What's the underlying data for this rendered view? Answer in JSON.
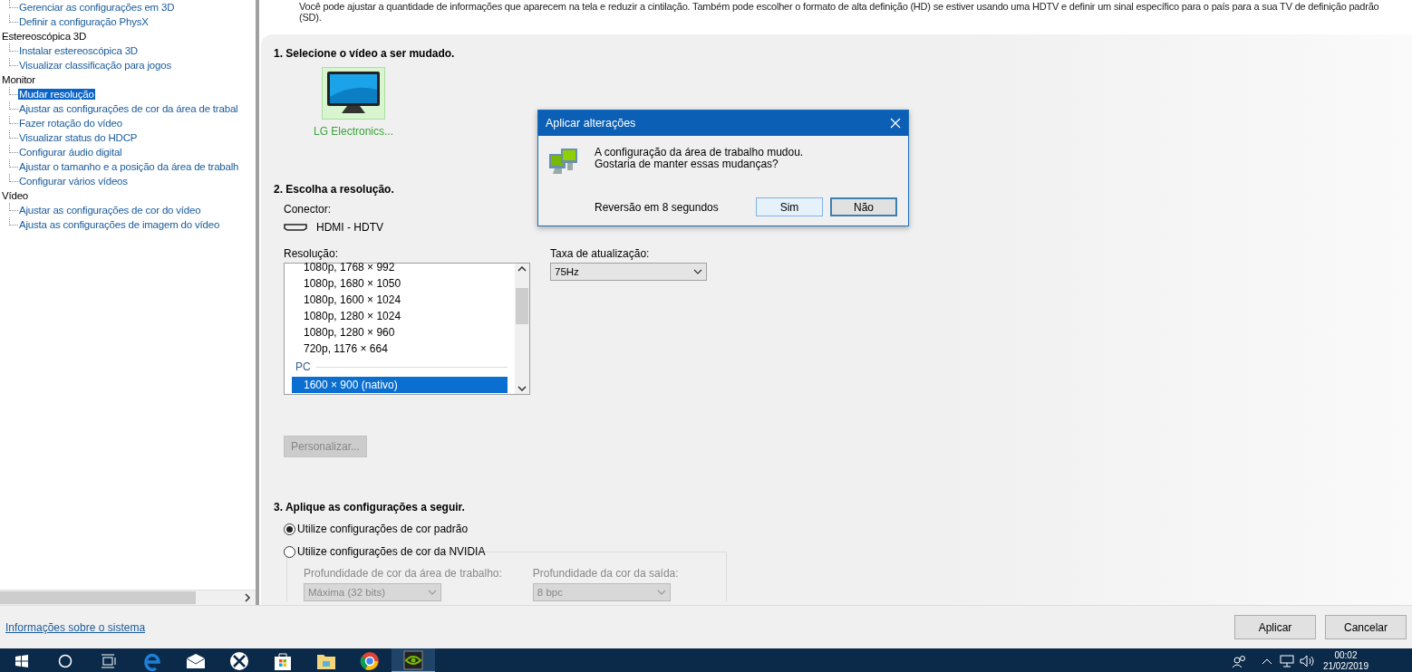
{
  "sidebar": {
    "items": [
      {
        "children": [
          {
            "label": "Gerenciar as configurações em 3D",
            "selected": false
          },
          {
            "label": "Definir a configuração PhysX",
            "selected": false
          }
        ]
      },
      {
        "label": "Estereoscópica 3D",
        "children": [
          {
            "label": "Instalar estereoscópica 3D",
            "selected": false
          },
          {
            "label": "Visualizar classificação para jogos",
            "selected": false
          }
        ]
      },
      {
        "label": "Monitor",
        "children": [
          {
            "label": "Mudar resolução",
            "selected": true
          },
          {
            "label": "Ajustar as configurações de cor da área de trabal",
            "selected": false
          },
          {
            "label": "Fazer rotação do vídeo",
            "selected": false
          },
          {
            "label": "Visualizar status do HDCP",
            "selected": false
          },
          {
            "label": "Configurar áudio digital",
            "selected": false
          },
          {
            "label": "Ajustar o tamanho e a posição da área de trabalh",
            "selected": false
          },
          {
            "label": "Configurar vários vídeos",
            "selected": false
          }
        ]
      },
      {
        "label": "Vídeo",
        "children": [
          {
            "label": "Ajustar as configurações de cor do vídeo",
            "selected": false
          },
          {
            "label": "Ajusta as configurações de imagem do vídeo",
            "selected": false
          }
        ]
      }
    ]
  },
  "description": "Você pode ajustar a quantidade de informações que aparecem na tela e reduzir  a cintilação. Também pode escolher o formato de alta definição (HD) se estiver usando uma HDTV e definir um sinal específico para o país para a sua TV de definição padrão (SD).",
  "section_1": {
    "heading": "1. Selecione o vídeo a ser mudado.",
    "displays": [
      {
        "label": "LG Electronics...",
        "selected": true
      }
    ]
  },
  "section_2": {
    "heading": "2. Escolha a resolução.",
    "connector_label": "Conector:",
    "connector": "HDMI - HDTV",
    "resolution_label": "Resolução:",
    "resolutions": [
      {
        "kind": "item",
        "label": "1080p, 1768 × 992",
        "selected": false
      },
      {
        "kind": "item",
        "label": "1080p, 1680 × 1050",
        "selected": false
      },
      {
        "kind": "item",
        "label": "1080p, 1600 × 1024",
        "selected": false
      },
      {
        "kind": "item",
        "label": "1080p, 1280 × 1024",
        "selected": false
      },
      {
        "kind": "item",
        "label": "1080p, 1280 × 960",
        "selected": false
      },
      {
        "kind": "item",
        "label": "720p, 1176 × 664",
        "selected": false
      },
      {
        "kind": "group",
        "label": "PC"
      },
      {
        "kind": "item",
        "label": "1600 × 900 (nativo)",
        "selected": true
      }
    ],
    "refresh_label": "Taxa de atualização:",
    "refresh_value": "75Hz",
    "customize_button": {
      "label": "Personalizar...",
      "disabled": true
    }
  },
  "section_3": {
    "heading": "3. Aplique as configurações a seguir.",
    "options": [
      {
        "label": "Utilize configurações de cor padrão",
        "selected": true
      },
      {
        "label": "Utilize configurações de cor da NVIDIA",
        "selected": false
      }
    ],
    "fields": [
      {
        "label": "Profundidade de cor da área de trabalho:",
        "value": "Máxima (32 bits)",
        "disabled": true
      },
      {
        "label": "Profundidade da cor da saída:",
        "value": "8 bpc",
        "disabled": true
      }
    ]
  },
  "dialog": {
    "title": "Aplicar alterações",
    "message": [
      "A configuração da área de trabalho mudou.",
      "Gostaria de manter essas mudanças?"
    ],
    "countdown": "Reversão em 8 segundos",
    "buttons": [
      {
        "label": "Sim",
        "kind": "hover"
      },
      {
        "label": "Não",
        "kind": "default"
      }
    ]
  },
  "footer": {
    "link": "Informações sobre o sistema",
    "buttons": [
      "Aplicar",
      "Cancelar"
    ]
  },
  "taskbar": {
    "apps": [
      {
        "kind": "edge",
        "active": false
      },
      {
        "kind": "mail",
        "active": false
      },
      {
        "kind": "xbox",
        "active": false
      },
      {
        "kind": "store",
        "active": false
      },
      {
        "kind": "folder",
        "active": false
      },
      {
        "kind": "chrome",
        "active": false
      },
      {
        "kind": "nvidia",
        "active": true
      }
    ],
    "time": "00:02",
    "date": "21/02/2019"
  }
}
